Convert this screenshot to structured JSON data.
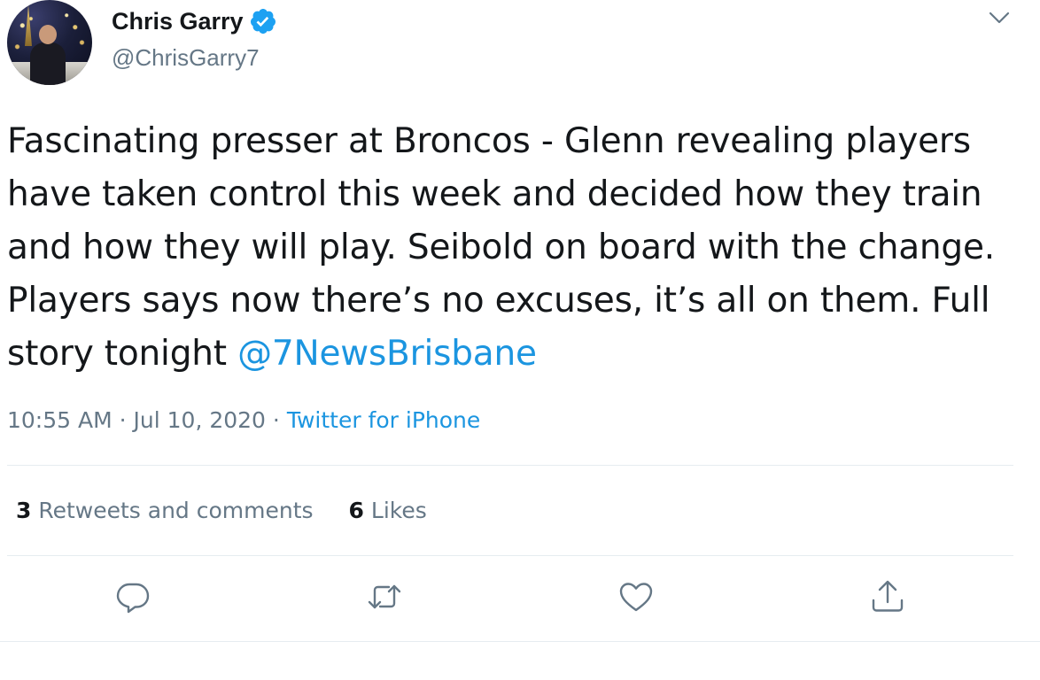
{
  "author": {
    "name": "Chris Garry",
    "handle": "@ChrisGarry7",
    "verified": true,
    "verified_color": "#1da1f2"
  },
  "tweet": {
    "text_before": "Fascinating presser at Broncos -  Glenn revealing players have taken control this week and decided how they train and how they will play. Seibold on board with the change. Players says now there’s no excuses, it’s all on them. Full story tonight ",
    "mention": "@7NewsBrisbane",
    "time": "10:55 AM",
    "separator1": " · ",
    "date": "Jul 10, 2020",
    "separator2": " · ",
    "source": "Twitter for iPhone"
  },
  "stats": {
    "retweets_count": "3",
    "retweets_label": " Retweets and comments",
    "likes_count": "6",
    "likes_label": " Likes"
  },
  "actions": {
    "reply_icon": "comment-icon",
    "retweet_icon": "retweet-icon",
    "like_icon": "heart-icon",
    "share_icon": "share-icon"
  },
  "colors": {
    "link": "#1b95e0",
    "secondary": "#657786",
    "divider": "#e6ecf0"
  }
}
